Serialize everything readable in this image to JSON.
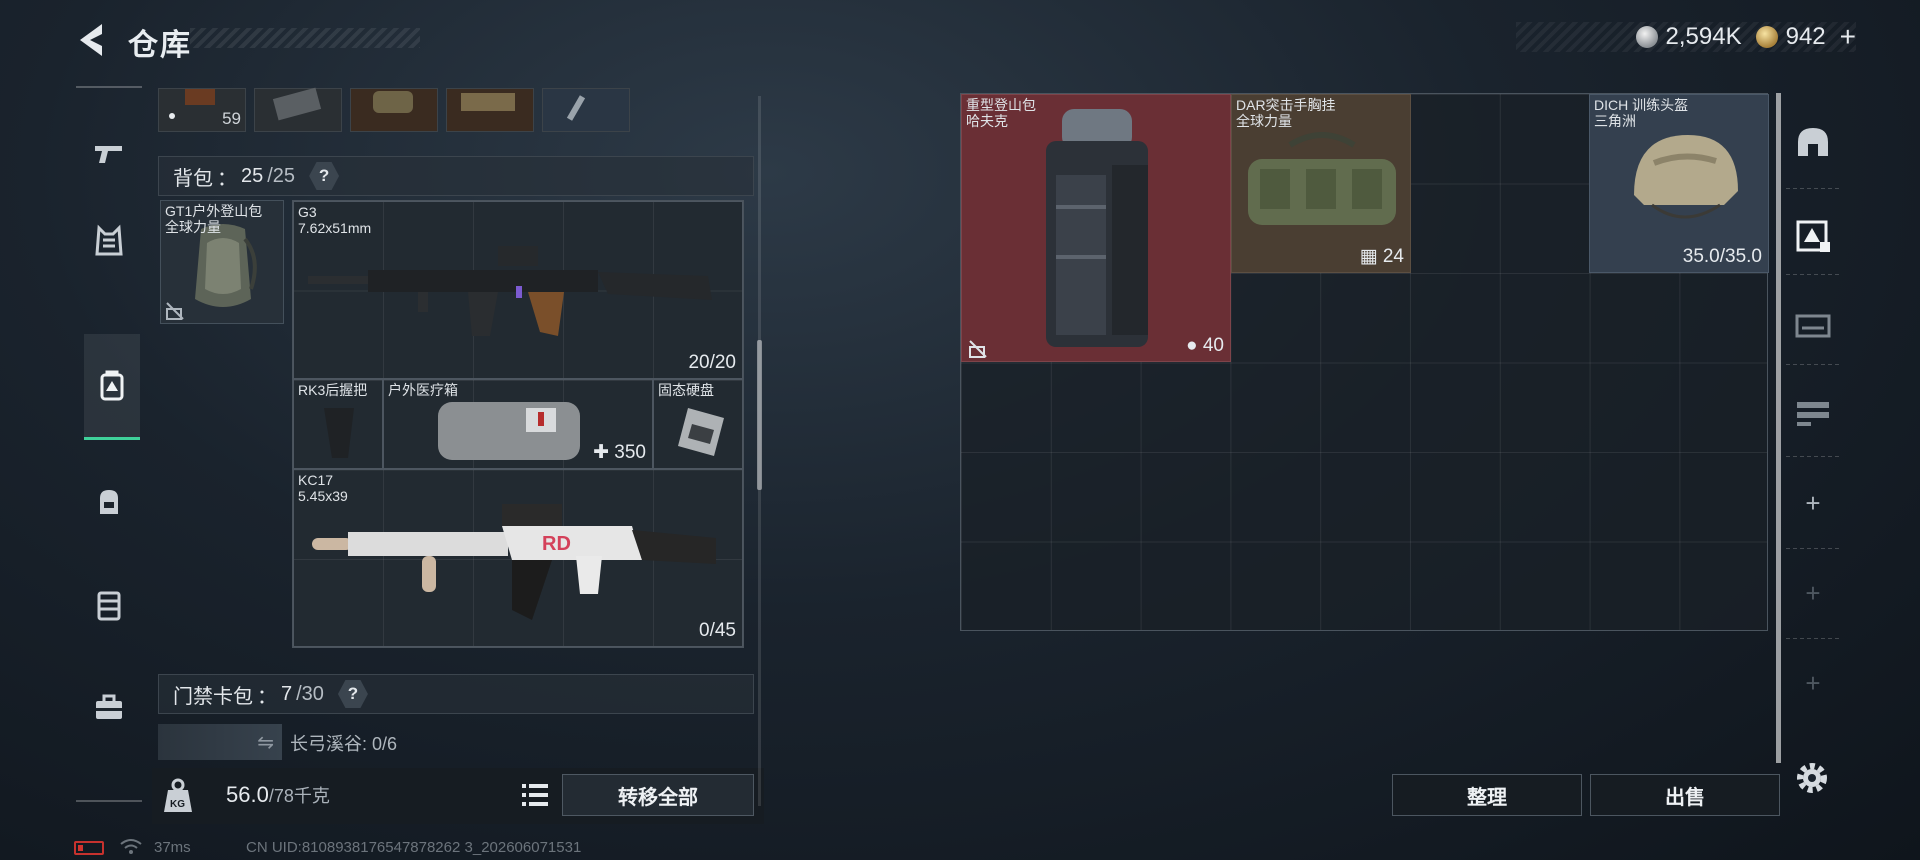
{
  "header": {
    "title": "仓库",
    "currencies": [
      {
        "icon": "silver-coin-icon",
        "amount": "2,594K"
      },
      {
        "icon": "gold-coin-icon",
        "amount": "942"
      }
    ],
    "add_symbol": "+"
  },
  "left_nav": [
    {
      "name": "weapons",
      "icon": "pistol-icon"
    },
    {
      "name": "armor",
      "icon": "vest-icon"
    },
    {
      "name": "items",
      "icon": "storage-icon",
      "active": true
    },
    {
      "name": "backpack",
      "icon": "backpack-icon"
    },
    {
      "name": "chest-rig",
      "icon": "rig-icon"
    },
    {
      "name": "toolbox",
      "icon": "toolbox-icon"
    }
  ],
  "inventory": {
    "top_strip_count": "59",
    "backpack": {
      "label": "背包",
      "sep": "：",
      "current": "25",
      "capacity": "/25",
      "help": "?"
    },
    "backpack_item": {
      "name": "GT1户外登山包\n全球力量"
    },
    "items": [
      {
        "name": "G3\n7.62x51mm",
        "count": "20/20"
      },
      {
        "name": "RK3后握把",
        "count": ""
      },
      {
        "name": "户外医疗箱",
        "count": "350"
      },
      {
        "name": "固态硬盘",
        "count": ""
      },
      {
        "name": "KC17\n5.45x39",
        "count": "0/45"
      }
    ],
    "keycard": {
      "label": "门禁卡包",
      "sep": "：",
      "current": "7",
      "capacity": "/30",
      "help": "?",
      "entry": "长弓溪谷: 0/6",
      "swap_symbol": "⇋"
    },
    "weight": {
      "current": "56.0",
      "capacity": "/78千克",
      "icon_text": "KG"
    },
    "transfer_all": "转移全部"
  },
  "stash": {
    "items": [
      {
        "name": "重型登山包\n哈夫克",
        "count": "40"
      },
      {
        "name": "DAR突击手胸挂\n全球力量",
        "count": "24"
      },
      {
        "name": "DICH 训练头盔\n三角洲",
        "count": "35.0/35.0"
      }
    ],
    "sort": "整理",
    "sell": "出售"
  },
  "right_nav": [
    {
      "icon": "helmet-slot-icon"
    },
    {
      "icon": "storage-slot-icon",
      "active": true
    },
    {
      "icon": "weapon-case-icon"
    },
    {
      "icon": "rifle-rack-icon"
    },
    {
      "icon": "add-slot-icon",
      "symbol": "+"
    },
    {
      "icon": "add-slot-icon",
      "symbol": "+"
    },
    {
      "icon": "add-slot-icon",
      "symbol": "+"
    }
  ],
  "status": {
    "ping": "37ms",
    "uid": "CN UID:8108938176547878262 3_202606071531"
  },
  "colors": {
    "accent": "#3fd19a",
    "stash_red_tile": "#6a2f35",
    "stash_brown_tile": "#4a3e32",
    "stash_blue_tile": "#34404f",
    "battery_low": "#c7322e"
  }
}
